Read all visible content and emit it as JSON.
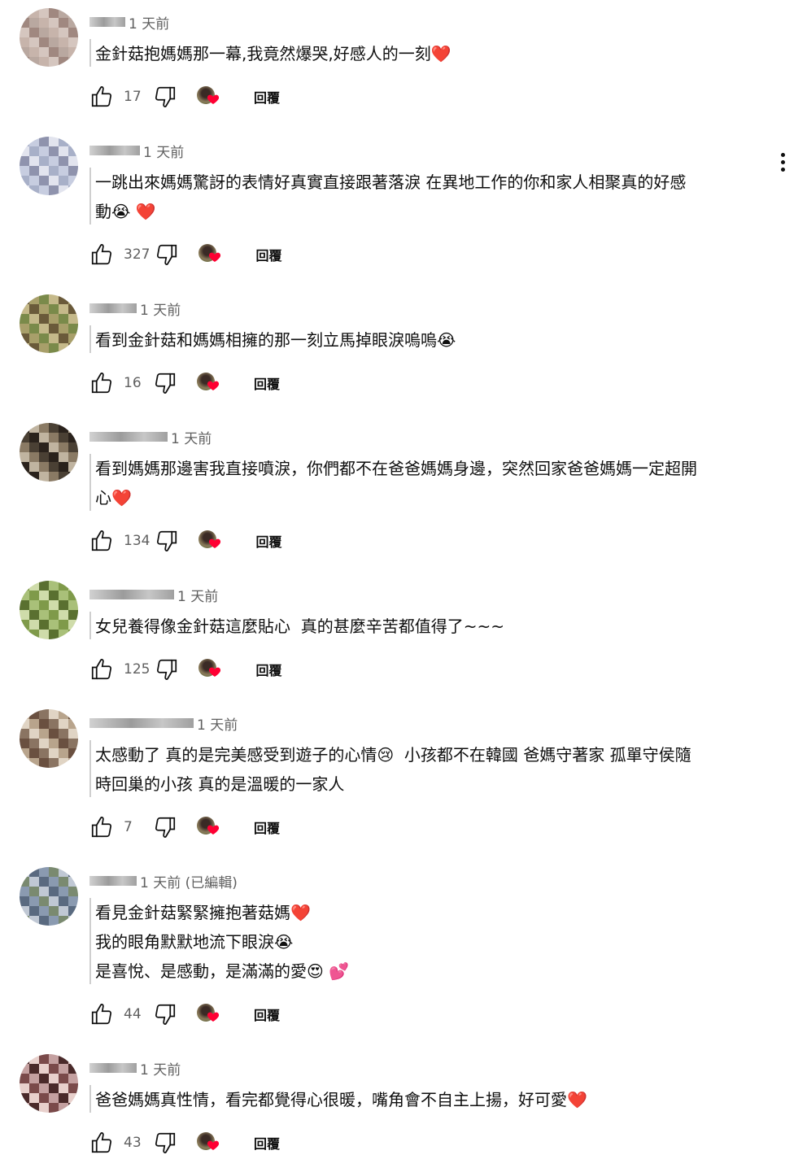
{
  "comments": [
    {
      "time": "1 天前",
      "lines": [
        "金針菇抱媽媽那一幕,我竟然爆哭,好感人的一刻❤️"
      ],
      "likes": "17",
      "reply": "回覆"
    },
    {
      "time": "1 天前",
      "lines": [
        "一跳出來媽媽驚訝的表情好真實直接跟著落淚 在異地工作的你和家人相聚真的好感",
        "動😭 ❤️"
      ],
      "likes": "327",
      "reply": "回覆"
    },
    {
      "time": "1 天前",
      "lines": [
        "看到金針菇和媽媽相擁的那一刻立馬掉眼淚嗚嗚😭"
      ],
      "likes": "16",
      "reply": "回覆"
    },
    {
      "time": "1 天前",
      "lines": [
        "看到媽媽那邊害我直接噴淚，你們都不在爸爸媽媽身邊，突然回家爸爸媽媽一定超開",
        "心❤️"
      ],
      "likes": "134",
      "reply": "回覆"
    },
    {
      "time": "1 天前",
      "lines": [
        "女兒養得像金針菇這麼貼心  真的甚麼辛苦都值得了~~~"
      ],
      "likes": "125",
      "reply": "回覆"
    },
    {
      "time": "1 天前",
      "lines": [
        "太感動了 真的是完美感受到遊子的心情😢  小孩都不在韓國 爸媽守著家 孤單守侯隨",
        "時回巢的小孩 真的是溫暖的一家人"
      ],
      "likes": "7",
      "reply": "回覆"
    },
    {
      "time": "1 天前 (已編輯)",
      "lines": [
        "看見金針菇緊緊擁抱著菇媽❤️",
        "我的眼角默默地流下眼淚😭",
        "是喜悅、是感動，是滿滿的愛😍 💕"
      ],
      "likes": "44",
      "reply": "回覆"
    },
    {
      "time": "1 天前",
      "lines": [
        "爸爸媽媽真性情，看完都覺得心很暖，嘴角會不自主上揚，好可愛❤️"
      ],
      "likes": "43",
      "reply": "回覆"
    }
  ],
  "icons": {
    "like": "thumbs-up-icon",
    "dislike": "thumbs-down-icon",
    "creator_heart": "creator-heart-icon",
    "more": "more-vert-icon"
  },
  "colors": {
    "text": "#0f0f0f",
    "secondary": "#606060",
    "heart": "#ff0033"
  }
}
